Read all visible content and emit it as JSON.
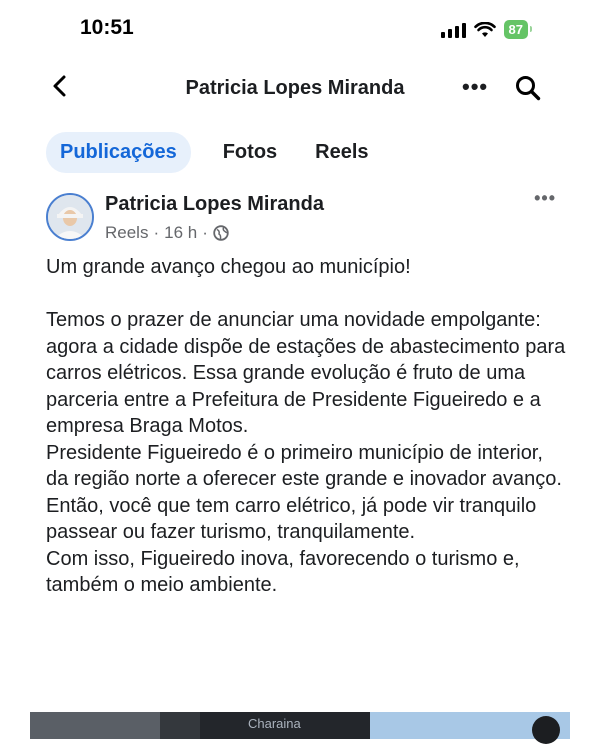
{
  "status_bar": {
    "time": "10:51",
    "battery": "87"
  },
  "nav": {
    "title": "Patricia Lopes Miranda"
  },
  "tabs": [
    {
      "label": "Publicações",
      "active": true
    },
    {
      "label": "Fotos",
      "active": false
    },
    {
      "label": "Reels",
      "active": false
    }
  ],
  "post": {
    "author": "Patricia Lopes Miranda",
    "source": "Reels",
    "time": "16 h",
    "privacy_icon": "globe-icon",
    "paragraphs": [
      "Um grande avanço chegou ao município!",
      "Temos o prazer de anunciar uma novidade empolgante: agora a cidade dispõe de estações de abastecimento para carros elétricos. Essa grande evolução é fruto de uma parceria entre a Prefeitura de Presidente Figueiredo e a empresa Braga Motos.",
      "Presidente Figueiredo é o primeiro município de interior, da região norte a oferecer este grande e inovador avanço.",
      "Então, você que tem carro elétrico, já pode vir tranquilo passear ou fazer turismo, tranquilamente.",
      "Com isso, Figueiredo inova,  favorecendo o turismo e, também o meio ambiente."
    ],
    "media_caption": "Charaina"
  },
  "colors": {
    "accent": "#1467d8",
    "tab_active_bg": "#e7f0fb",
    "meta": "#65676b",
    "battery": "#65c466"
  }
}
